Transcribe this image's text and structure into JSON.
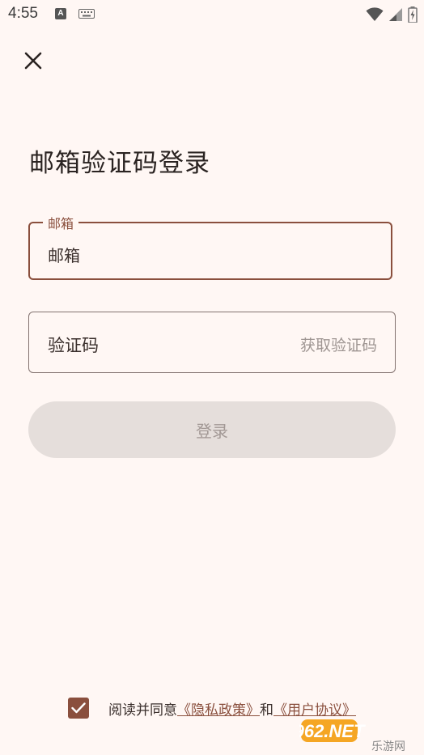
{
  "status_bar": {
    "time": "4:55",
    "a_icon": "A",
    "icons": [
      "text-a-icon",
      "keyboard-icon",
      "wifi-icon",
      "cellular-signal-icon",
      "battery-charging-icon"
    ]
  },
  "close_icon": "close-icon",
  "page_title": "邮箱验证码登录",
  "email": {
    "label": "邮箱",
    "value": "邮箱"
  },
  "code": {
    "placeholder": "验证码",
    "get_code_label": "获取验证码"
  },
  "login_button_label": "登录",
  "agreement": {
    "checked": true,
    "prefix": "阅读并同意",
    "privacy_link": "《隐私政策》",
    "connector": "和",
    "user_link": "《用户协议》"
  },
  "watermark": {
    "main": "962.NET",
    "sub": "乐游网"
  },
  "colors": {
    "background": "#FFF7F4",
    "accent": "#8A4F3D",
    "disabled_button": "#E5DEDB",
    "disabled_text": "#A29895"
  }
}
